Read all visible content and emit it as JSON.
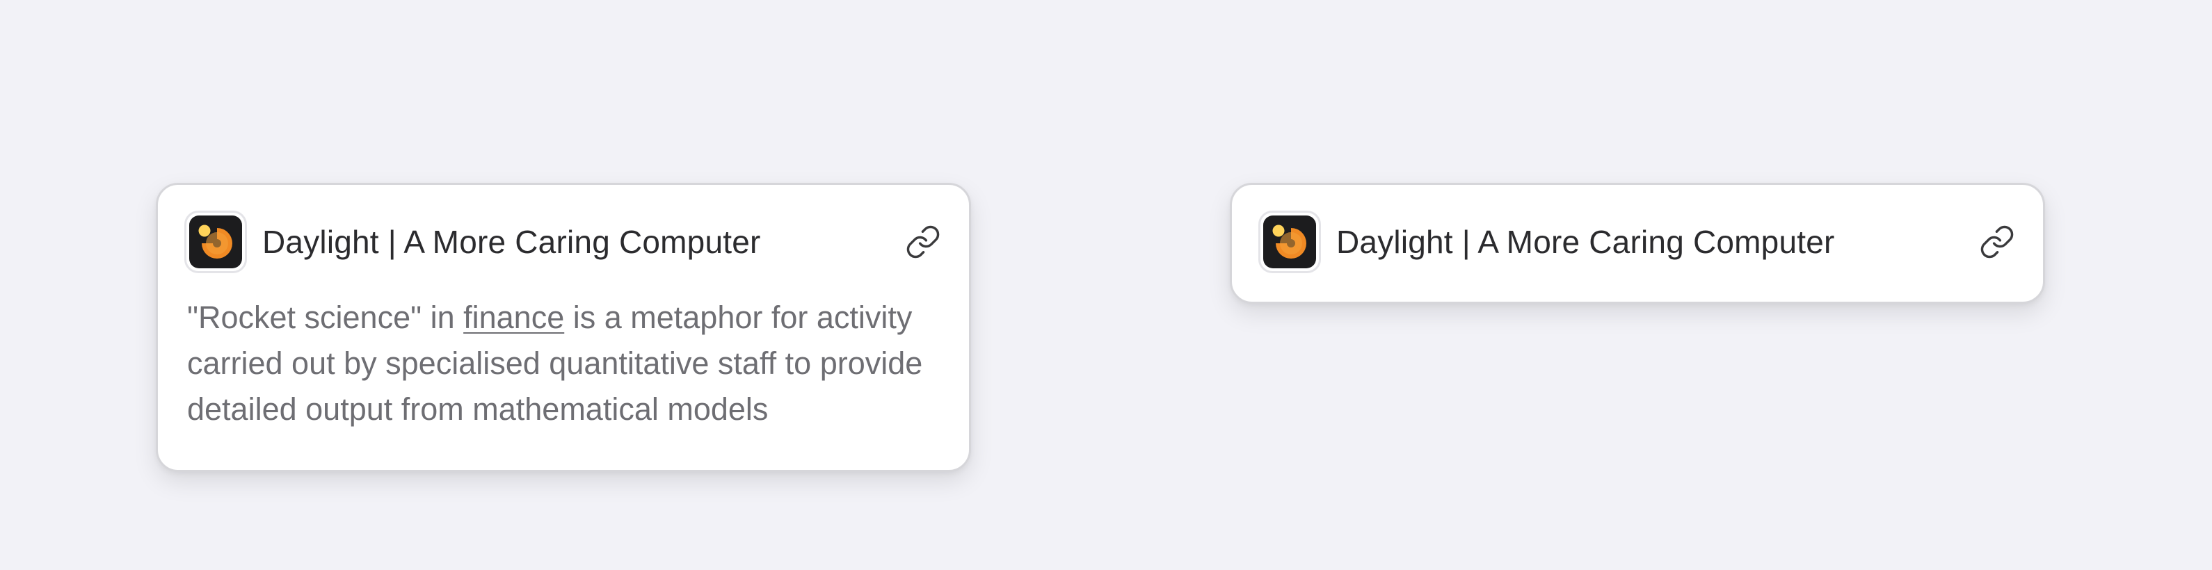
{
  "colors": {
    "background": "#f2f2f7",
    "card_background": "#ffffff",
    "title_text": "#2b2b2e",
    "body_text": "#6e6e73",
    "icon_dark": "#1c1c1e",
    "icon_orange": "#f08a24",
    "icon_yellow": "#ffd35a"
  },
  "cards": [
    {
      "variant": "expanded",
      "app_icon": "daylight-logo-icon",
      "title": "Daylight | A More Caring Computer",
      "link_icon": "link-icon",
      "description": {
        "before": "\"Rocket science\" in ",
        "link": "finance",
        "after": " is a metaphor for activity carried out by specialised quantitative staff to provide detailed output from mathematical models"
      }
    },
    {
      "variant": "compact",
      "app_icon": "daylight-logo-icon",
      "title": "Daylight | A More Caring Computer",
      "link_icon": "link-icon"
    }
  ]
}
